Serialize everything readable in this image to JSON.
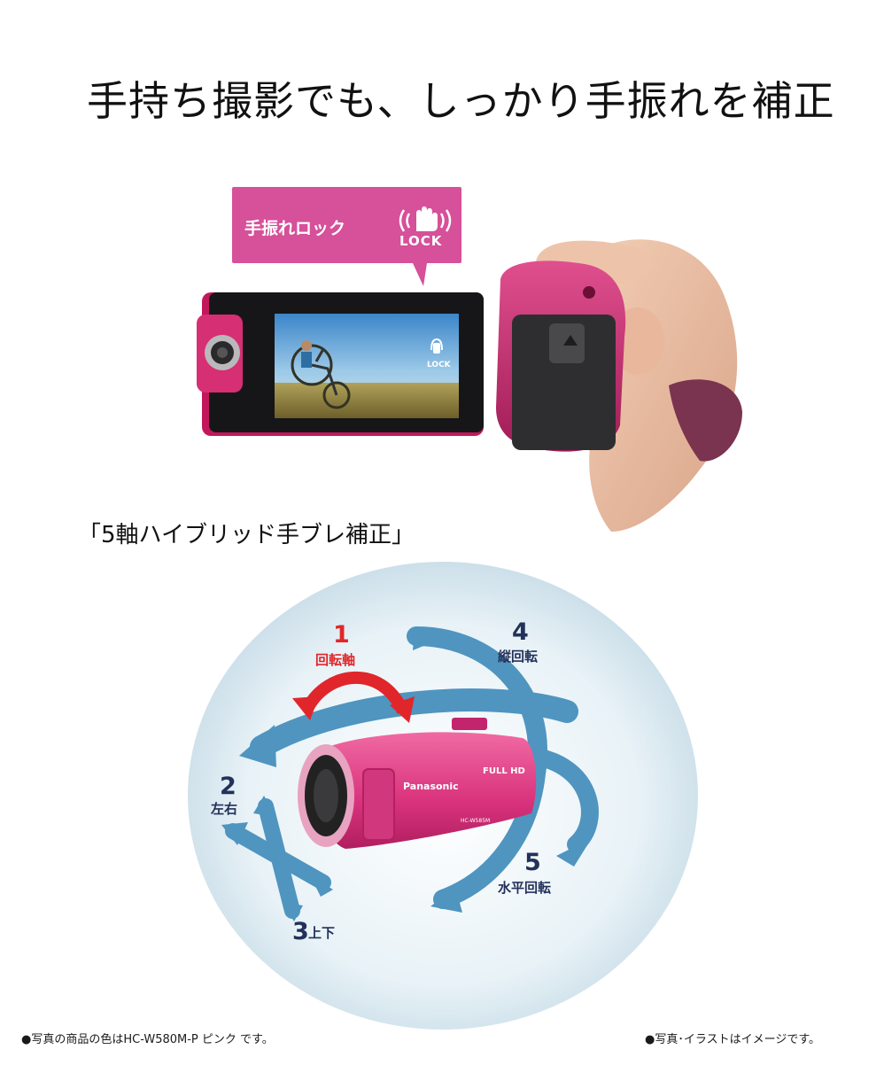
{
  "headline": "手持ち撮影でも、しっかり手振れを補正",
  "callout": {
    "text": "手振れロック",
    "lock_word": "LOCK"
  },
  "screen_badge": "LOCK",
  "feature_heading": "「5軸ハイブリッド手ブレ補正」",
  "axes": [
    {
      "number": "1",
      "label": "回転軸",
      "color": "#e0262b"
    },
    {
      "number": "2",
      "label": "左右"
    },
    {
      "number": "3",
      "label": "上下"
    },
    {
      "number": "4",
      "label": "縦回転"
    },
    {
      "number": "5",
      "label": "水平回転"
    }
  ],
  "camera_markings": {
    "brand": "Panasonic",
    "badge": "FULL HD",
    "model": "HC-W585M"
  },
  "footnotes": {
    "left": "●写真の商品の色はHC-W580M-P ピンク です。",
    "right": "●写真･イラストはイメージです。"
  },
  "colors": {
    "accent_pink": "#d6509a",
    "arrow_blue": "#4f95bf",
    "axis_text": "#23315a"
  },
  "icons": [
    "hand-lock-icon"
  ]
}
